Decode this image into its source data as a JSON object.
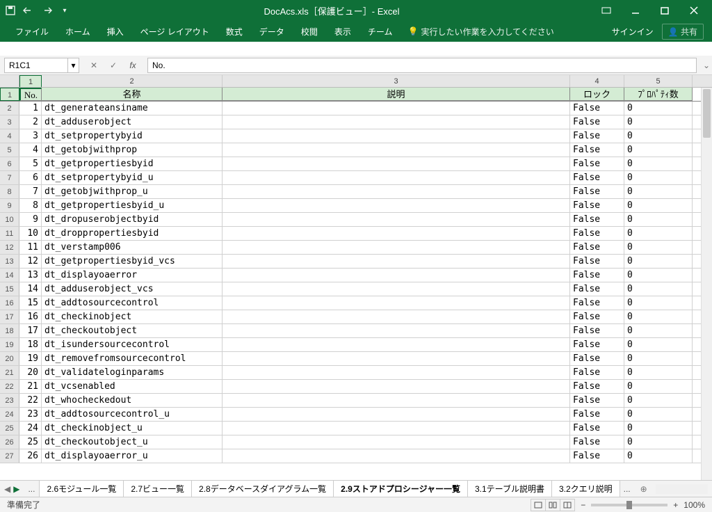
{
  "title": "DocAcs.xls［保護ビュー］- Excel",
  "qat": {
    "save": "save",
    "undo": "undo",
    "redo": "redo",
    "customize": "customize"
  },
  "tabs": [
    "ファイル",
    "ホーム",
    "挿入",
    "ページ レイアウト",
    "数式",
    "データ",
    "校閲",
    "表示",
    "チーム"
  ],
  "tellme": "実行したい作業を入力してください",
  "signin": "サインイン",
  "share": "共有",
  "namebox": "R1C1",
  "formula": "No.",
  "colnums": [
    "1",
    "2",
    "3",
    "4",
    "5"
  ],
  "headers": {
    "no": "No.",
    "name": "名称",
    "desc": "説明",
    "lock": "ロック",
    "props": "ﾌﾟﾛﾊﾟﾃｨ数"
  },
  "rows": [
    {
      "n": "1",
      "name": "dt_generateansiname",
      "lock": "False",
      "p": "0"
    },
    {
      "n": "2",
      "name": "dt_adduserobject",
      "lock": "False",
      "p": "0"
    },
    {
      "n": "3",
      "name": "dt_setpropertybyid",
      "lock": "False",
      "p": "0"
    },
    {
      "n": "4",
      "name": "dt_getobjwithprop",
      "lock": "False",
      "p": "0"
    },
    {
      "n": "5",
      "name": "dt_getpropertiesbyid",
      "lock": "False",
      "p": "0"
    },
    {
      "n": "6",
      "name": "dt_setpropertybyid_u",
      "lock": "False",
      "p": "0"
    },
    {
      "n": "7",
      "name": "dt_getobjwithprop_u",
      "lock": "False",
      "p": "0"
    },
    {
      "n": "8",
      "name": "dt_getpropertiesbyid_u",
      "lock": "False",
      "p": "0"
    },
    {
      "n": "9",
      "name": "dt_dropuserobjectbyid",
      "lock": "False",
      "p": "0"
    },
    {
      "n": "10",
      "name": "dt_droppropertiesbyid",
      "lock": "False",
      "p": "0"
    },
    {
      "n": "11",
      "name": "dt_verstamp006",
      "lock": "False",
      "p": "0"
    },
    {
      "n": "12",
      "name": "dt_getpropertiesbyid_vcs",
      "lock": "False",
      "p": "0"
    },
    {
      "n": "13",
      "name": "dt_displayoaerror",
      "lock": "False",
      "p": "0"
    },
    {
      "n": "14",
      "name": "dt_adduserobject_vcs",
      "lock": "False",
      "p": "0"
    },
    {
      "n": "15",
      "name": "dt_addtosourcecontrol",
      "lock": "False",
      "p": "0"
    },
    {
      "n": "16",
      "name": "dt_checkinobject",
      "lock": "False",
      "p": "0"
    },
    {
      "n": "17",
      "name": "dt_checkoutobject",
      "lock": "False",
      "p": "0"
    },
    {
      "n": "18",
      "name": "dt_isundersourcecontrol",
      "lock": "False",
      "p": "0"
    },
    {
      "n": "19",
      "name": "dt_removefromsourcecontrol",
      "lock": "False",
      "p": "0"
    },
    {
      "n": "20",
      "name": "dt_validateloginparams",
      "lock": "False",
      "p": "0"
    },
    {
      "n": "21",
      "name": "dt_vcsenabled",
      "lock": "False",
      "p": "0"
    },
    {
      "n": "22",
      "name": "dt_whocheckedout",
      "lock": "False",
      "p": "0"
    },
    {
      "n": "23",
      "name": "dt_addtosourcecontrol_u",
      "lock": "False",
      "p": "0"
    },
    {
      "n": "24",
      "name": "dt_checkinobject_u",
      "lock": "False",
      "p": "0"
    },
    {
      "n": "25",
      "name": "dt_checkoutobject_u",
      "lock": "False",
      "p": "0"
    },
    {
      "n": "26",
      "name": "dt_displayoaerror_u",
      "lock": "False",
      "p": "0"
    }
  ],
  "sheets": {
    "more": "...",
    "items": [
      "2.6モジュール一覧",
      "2.7ビュー一覧",
      "2.8データベースダイアグラム一覧",
      "2.9ストアドプロシージャー一覧",
      "3.1テーブル説明書",
      "3.2クエリ説明"
    ],
    "active_index": 3,
    "truncated": "..."
  },
  "status": {
    "ready": "準備完了",
    "zoom": "100%"
  }
}
